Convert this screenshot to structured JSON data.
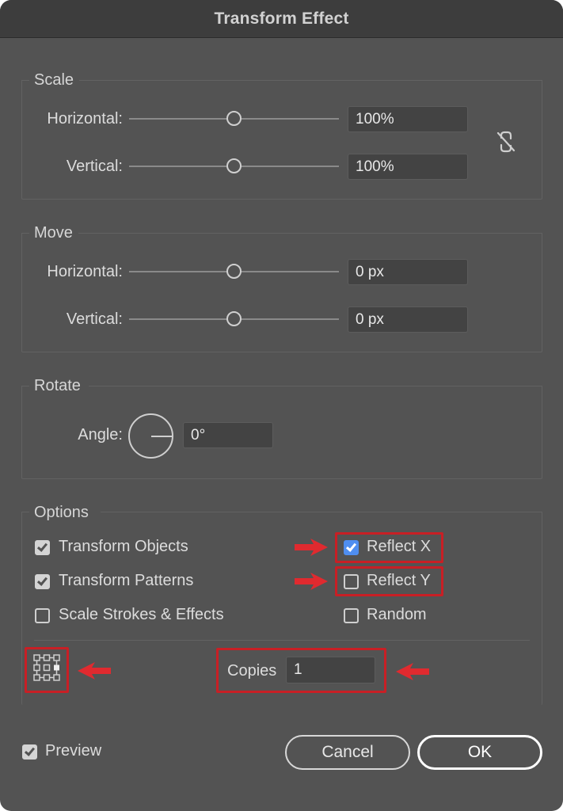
{
  "window": {
    "title": "Transform Effect"
  },
  "scale": {
    "label": "Scale",
    "horizontal": {
      "label": "Horizontal:",
      "value": "100%"
    },
    "vertical": {
      "label": "Vertical:",
      "value": "100%"
    },
    "constrain_icon": "unlinked-chain-icon"
  },
  "move": {
    "label": "Move",
    "horizontal": {
      "label": "Horizontal:",
      "value": "0 px"
    },
    "vertical": {
      "label": "Vertical:",
      "value": "0 px"
    }
  },
  "rotate": {
    "label": "Rotate",
    "angle": {
      "label": "Angle:",
      "value": "0°"
    },
    "dial_icon": "angle-dial-icon"
  },
  "options": {
    "label": "Options",
    "transform_objects": {
      "label": "Transform Objects",
      "checked": true
    },
    "transform_patterns": {
      "label": "Transform Patterns",
      "checked": true
    },
    "scale_strokes": {
      "label": "Scale Strokes & Effects",
      "checked": false
    },
    "reflect_x": {
      "label": "Reflect X",
      "checked": true
    },
    "reflect_y": {
      "label": "Reflect Y",
      "checked": false
    },
    "random": {
      "label": "Random",
      "checked": false
    },
    "reference_point_icon": "reference-point-grid-icon",
    "copies": {
      "label": "Copies",
      "value": "1"
    }
  },
  "footer": {
    "preview": {
      "label": "Preview",
      "checked": true
    },
    "cancel_label": "Cancel",
    "ok_label": "OK"
  },
  "colors": {
    "dialog_bg": "#535353",
    "titlebar_bg": "#3d3d3d",
    "field_bg": "#434343",
    "checkbox_accent": "#4f8ef0",
    "highlight": "#c81f25"
  }
}
